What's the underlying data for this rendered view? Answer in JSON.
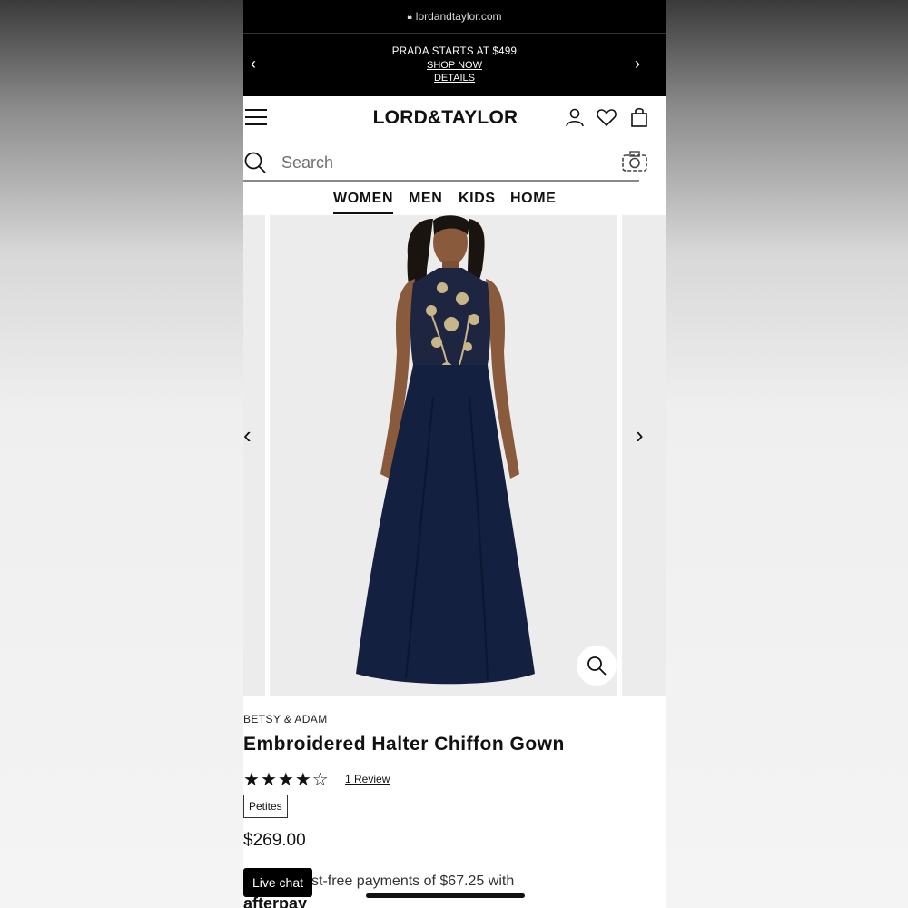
{
  "browser": {
    "url": "lordandtaylor.com"
  },
  "promo": {
    "title": "PRADA STARTS AT $499",
    "shop_now": "SHOP NOW",
    "details": "DETAILS",
    "prev_icon": "chevron-left",
    "next_icon": "chevron-right"
  },
  "header": {
    "logo": "LORD&TAYLOR",
    "icons": [
      "menu-icon",
      "account-icon",
      "heart-icon",
      "bag-icon"
    ]
  },
  "search": {
    "placeholder": "Search",
    "camera_icon": "camera-icon"
  },
  "nav": {
    "tabs": [
      "WOMEN",
      "MEN",
      "KIDS",
      "HOME"
    ],
    "active": "WOMEN"
  },
  "product": {
    "brand": "BETSY & ADAM",
    "name": "Embroidered Halter Chiffon Gown",
    "rating": 4,
    "rating_max": 5,
    "reviews_label": "1 Review",
    "size_badge": "Petites",
    "price": "$269.00",
    "payments_text": "st-free payments of $67.25 with",
    "afterpay_label": "afterpay"
  },
  "colors": {
    "dress": "#14203f",
    "embroidery": "#c9b58a",
    "image_bg": "#ececec",
    "black": "#000000"
  },
  "live_chat": {
    "label": "Live chat"
  }
}
